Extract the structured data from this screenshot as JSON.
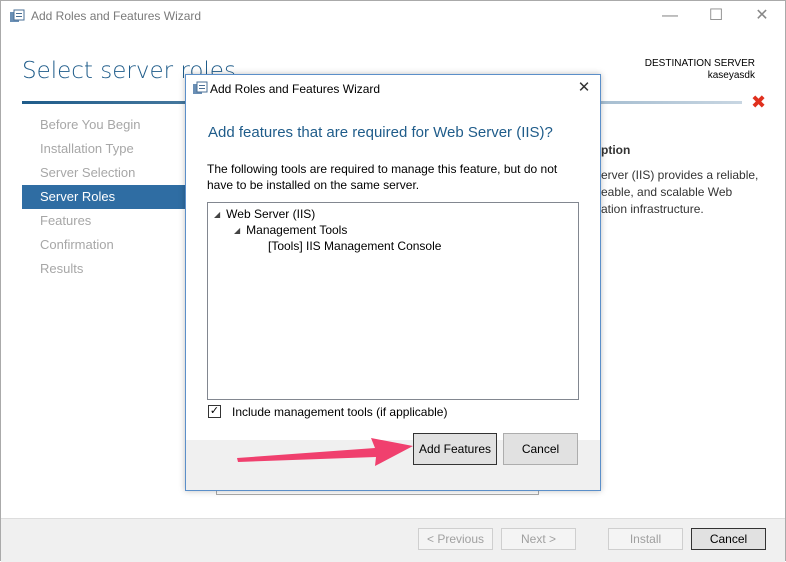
{
  "window": {
    "title": "Add Roles and Features Wizard",
    "minimize_glyph": "—",
    "maximize_glyph": "☐",
    "close_glyph": "✕"
  },
  "header": {
    "page_title": "Select server roles",
    "destination_label": "DESTINATION SERVER",
    "destination_server": "kaseyasdk",
    "alert_icon": "red-x-icon"
  },
  "nav": {
    "items": [
      {
        "label": "Before You Begin",
        "active": false
      },
      {
        "label": "Installation Type",
        "active": false
      },
      {
        "label": "Server Selection",
        "active": false
      },
      {
        "label": "Server Roles",
        "active": true
      },
      {
        "label": "Features",
        "active": false
      },
      {
        "label": "Confirmation",
        "active": false
      },
      {
        "label": "Results",
        "active": false
      }
    ]
  },
  "description": {
    "heading": "ption",
    "text_lines": [
      "erver (IIS) provides a reliable,",
      "eable, and scalable Web",
      "ation infrastructure."
    ]
  },
  "footer": {
    "previous": "< Previous",
    "next": "Next >",
    "install": "Install",
    "cancel": "Cancel"
  },
  "dialog": {
    "title": "Add Roles and Features Wizard",
    "close_glyph": "✕",
    "heading": "Add features that are required for Web Server (IIS)?",
    "description": "The following tools are required to manage this feature, but do not have to be installed on the same server.",
    "tree": {
      "level0": "Web Server (IIS)",
      "level1": "Management Tools",
      "level2": "[Tools] IIS Management Console"
    },
    "include_tools_label": "Include management tools (if applicable)",
    "include_tools_checked": true,
    "add_features": "Add Features",
    "cancel": "Cancel"
  },
  "colors": {
    "accent": "#1f5c8a",
    "nav_active": "#2f6da3",
    "arrow": "#f0406e",
    "alert": "#e0301e"
  }
}
